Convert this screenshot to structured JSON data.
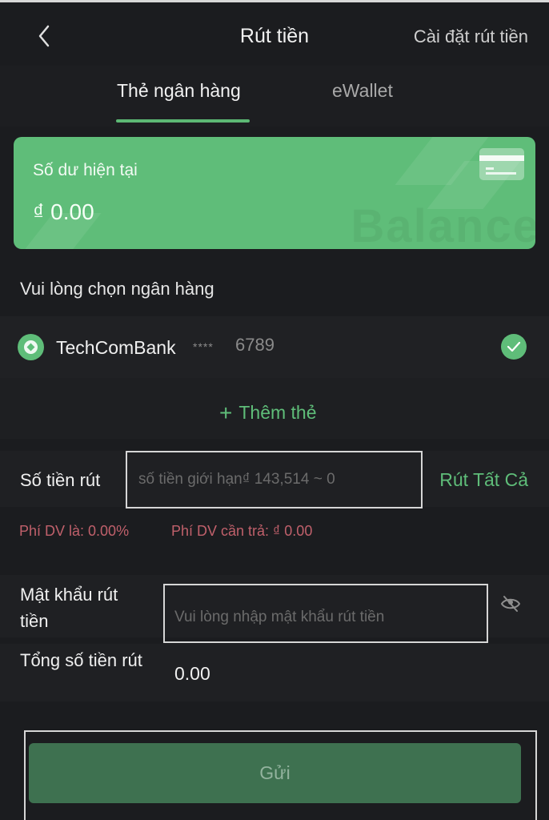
{
  "header": {
    "title": "Rút tiền",
    "settings_link": "Cài đặt rút tiền",
    "back_icon": "chevron-left-icon"
  },
  "tabs": [
    {
      "label": "Thẻ ngân hàng",
      "active": true
    },
    {
      "label": "eWallet",
      "active": false
    }
  ],
  "balance_card": {
    "label": "Số dư hiện tại",
    "amount": "₫ 0.00",
    "watermark": "Balance",
    "icon": "credit-card-icon"
  },
  "bank_section": {
    "label": "Vui lòng chọn ngân hàng",
    "selected_bank": {
      "name": "TechComBank",
      "mask": "****",
      "last4": "6789",
      "selected": true
    },
    "add_card_label": "Thêm thẻ",
    "add_card_icon": "plus-icon"
  },
  "amount": {
    "label": "Số tiền rút",
    "placeholder": "số tiền giới hạn₫ 143,514 ~ 0",
    "value": "",
    "withdraw_all_label": "Rút Tất Cả"
  },
  "fees": {
    "rate_text": "Phí DV là: 0.00%",
    "payable_text": "Phí DV cần trả: ₫ 0.00"
  },
  "password": {
    "label": "Mật khẩu rút tiền",
    "placeholder": "Vui lòng nhập mật khẩu rút tiền",
    "value": "",
    "visibility_icon": "eye-off-icon"
  },
  "total": {
    "label": "Tổng số tiền rút",
    "value": "0.00"
  },
  "submit": {
    "label": "Gửi",
    "enabled": false
  },
  "colors": {
    "accent": "#5fbd79",
    "background": "#1b1c1f",
    "row": "#1f2023",
    "fee_text": "#c0606b",
    "button_disabled": "#3e7150"
  }
}
